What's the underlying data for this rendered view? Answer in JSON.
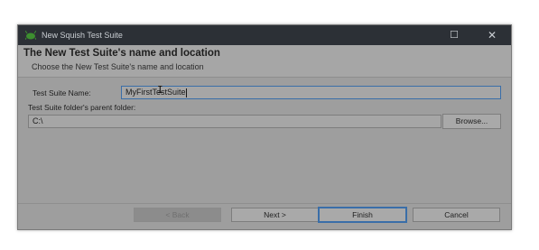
{
  "window": {
    "title": "New Squish Test Suite",
    "maximize_glyph": "☐",
    "close_glyph": "✕"
  },
  "banner": {
    "heading": "The New Test Suite's name and location",
    "subheading": "Choose the New Test Suite's name and location"
  },
  "form": {
    "name_label": "Test Suite Name:",
    "name_value": "MyFirstTestSuite",
    "parent_label": "Test Suite folder's parent folder:",
    "parent_value": "C:\\",
    "browse_label": "Browse..."
  },
  "buttons": {
    "back_label": "< Back",
    "next_label": "Next >",
    "finish_label": "Finish",
    "cancel_label": "Cancel"
  },
  "icons": {
    "app_icon": "squish-app-icon",
    "maximize": "maximize-icon",
    "close": "close-icon"
  },
  "colors": {
    "titlebar": "#2c3036",
    "focus_border": "#3a6ea8",
    "app_icon_green": "#3d8f2f"
  }
}
